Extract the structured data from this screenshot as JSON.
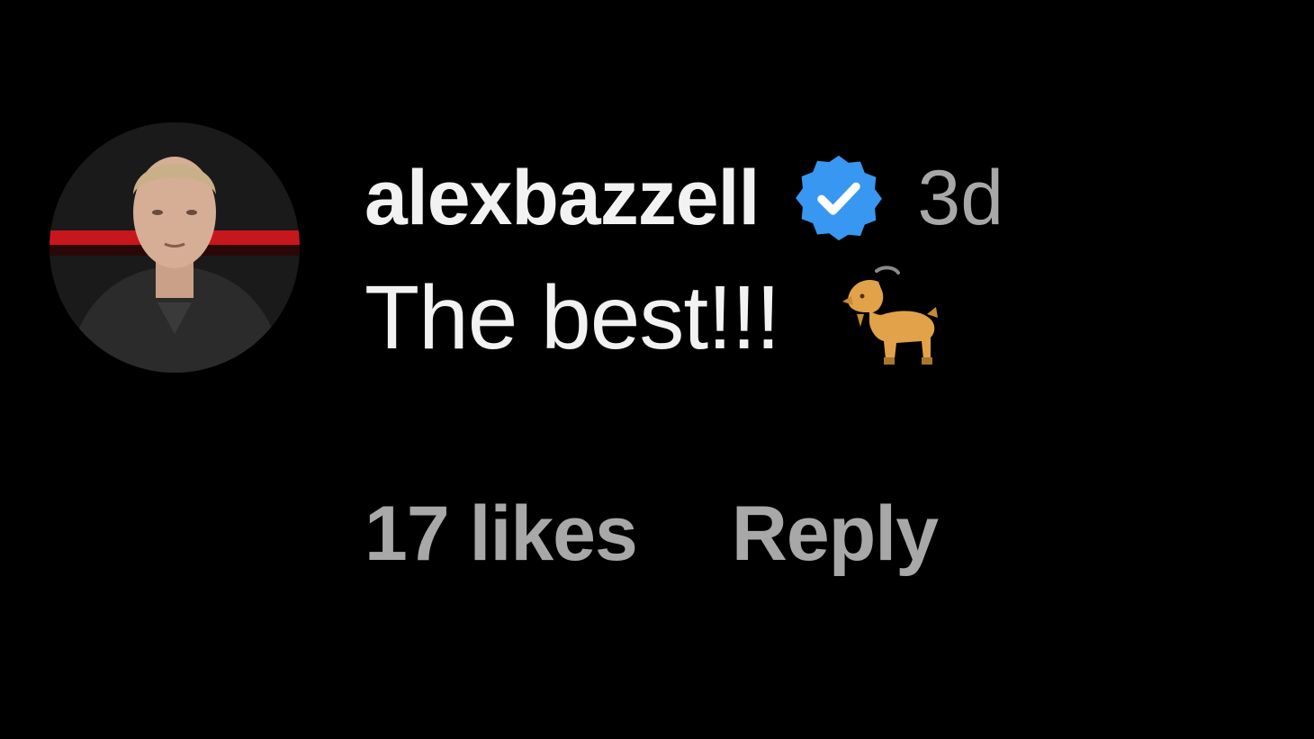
{
  "comment": {
    "username": "alexbazzell",
    "verified_icon": "verified-badge-icon",
    "time_ago": "3d",
    "text": "The best!!!",
    "emoji_icon": "goat-emoji-icon",
    "likes": "17 likes",
    "reply_label": "Reply"
  },
  "colors": {
    "background": "#000000",
    "primary_text": "#f2f2f2",
    "secondary_text": "#a8a8a8",
    "verified_blue": "#3897f0"
  }
}
